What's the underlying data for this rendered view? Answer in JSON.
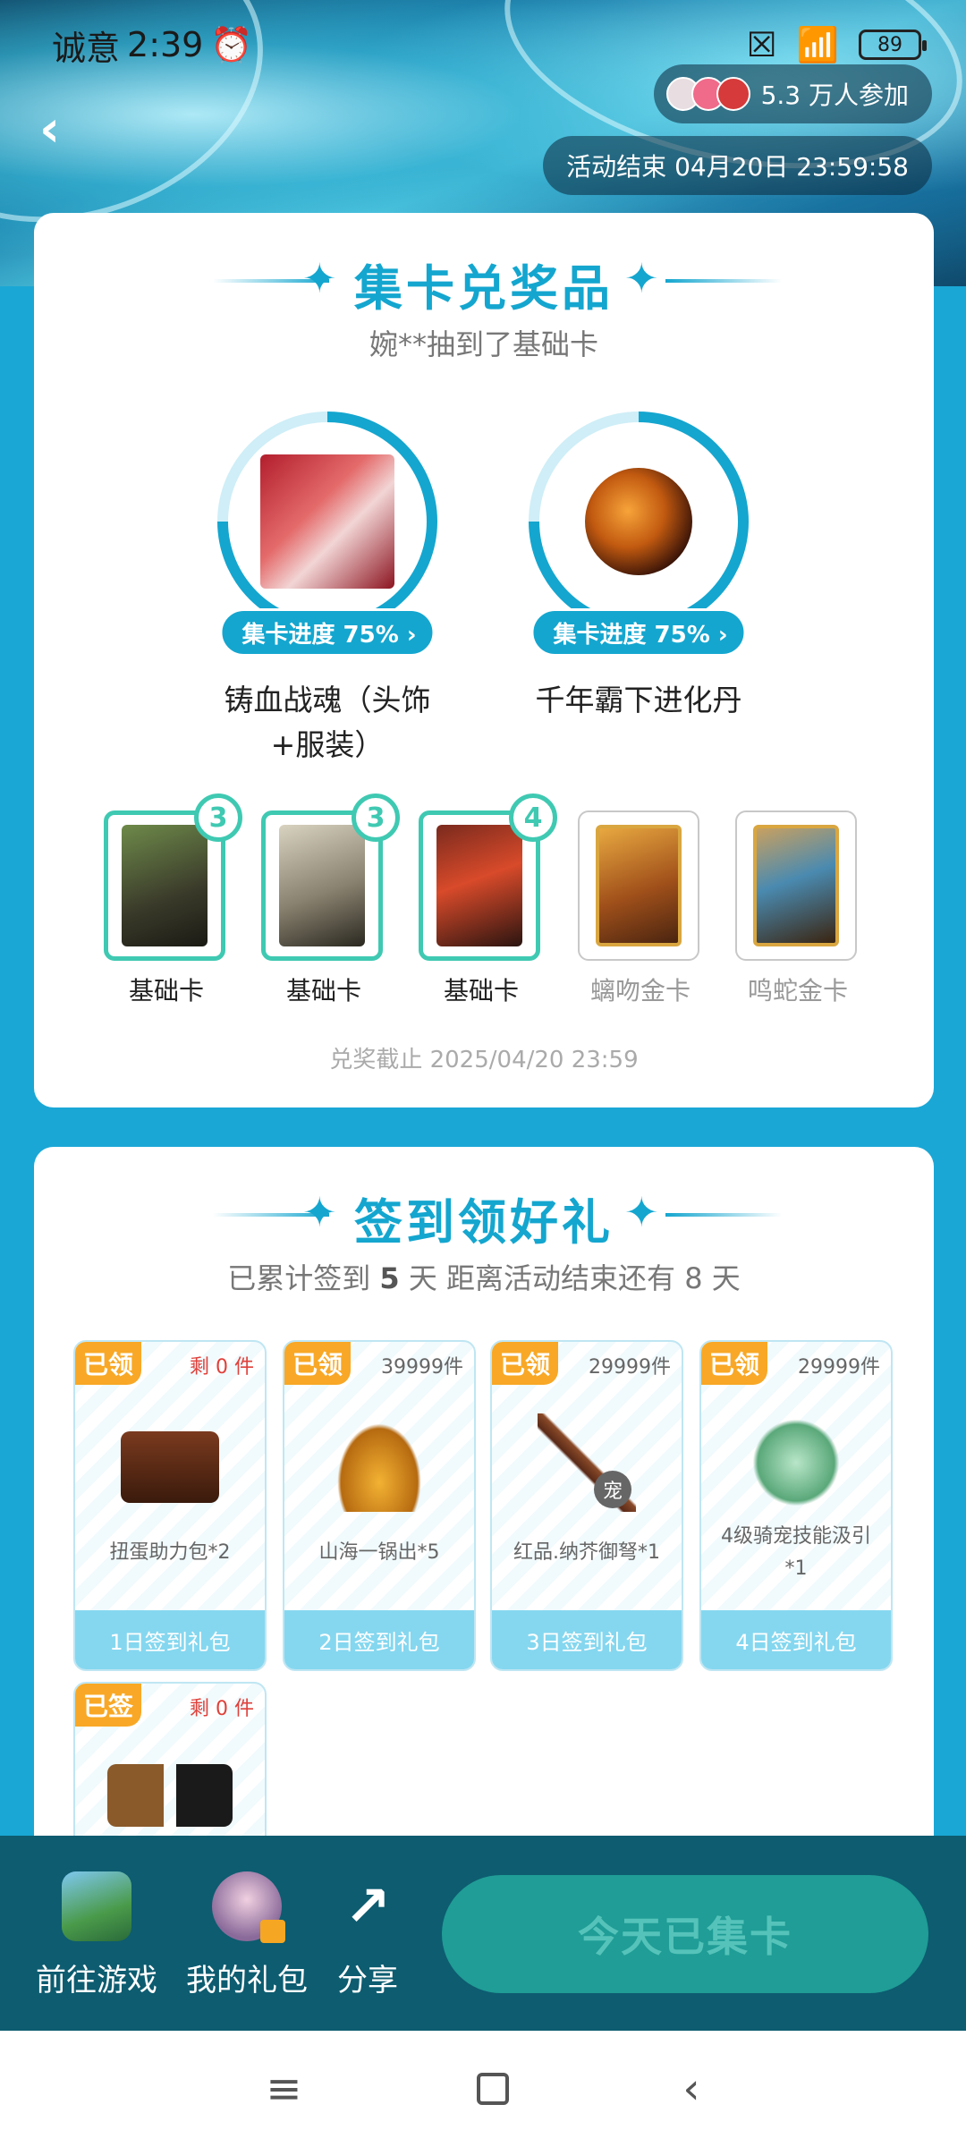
{
  "status_bar": {
    "time": "2:39",
    "carrier": "诚意",
    "battery": "89"
  },
  "header": {
    "participants": "5.3 万人参加",
    "end_time": "活动结束 04月20日 23:59:58"
  },
  "collect": {
    "title": "集卡兑奖品",
    "ticker": "婉**抽到了基础卡",
    "prizes": [
      {
        "progress_label": "集卡进度 75%",
        "progress": 0.75,
        "name_line1": "铸血战魂（头饰",
        "name_line2": "+服装）"
      },
      {
        "progress_label": "集卡进度 75%",
        "progress": 0.75,
        "name_line1": "千年霸下进化丹",
        "name_line2": ""
      }
    ],
    "cards": [
      {
        "name": "基础卡",
        "count": "3",
        "owned": true
      },
      {
        "name": "基础卡",
        "count": "3",
        "owned": true
      },
      {
        "name": "基础卡",
        "count": "4",
        "owned": true
      },
      {
        "name": "螭吻金卡",
        "count": "",
        "owned": false
      },
      {
        "name": "鸣蛇金卡",
        "count": "",
        "owned": false
      }
    ],
    "deadline": "兑奖截止 2025/04/20 23:59"
  },
  "signin": {
    "title": "签到领好礼",
    "summary_prefix": "已累计签到",
    "summary_days": "5",
    "summary_mid": "天  距离活动结束还有",
    "summary_remain": "8",
    "summary_suffix": "天",
    "gifts": [
      {
        "tag": "已领",
        "stock": "剩 0 件",
        "name": "扭蛋助力包*2",
        "footer": "1日签到礼包"
      },
      {
        "tag": "已领",
        "stock": "39999件",
        "name": "山海一锅出*5",
        "footer": "2日签到礼包"
      },
      {
        "tag": "已领",
        "stock": "29999件",
        "name": "红品.纳芥御弩*1",
        "footer": "3日签到礼包",
        "badge": "宠"
      },
      {
        "tag": "已领",
        "stock": "29999件",
        "name": "4级骑宠技能汲引*1",
        "footer": "4日签到礼包"
      },
      {
        "tag": "已签",
        "stock": "剩 0 件",
        "name": "",
        "footer": ""
      }
    ]
  },
  "bottom_bar": {
    "game": "前往游戏",
    "gifts": "我的礼包",
    "share": "分享",
    "collect_button": "今天已集卡"
  },
  "colors": {
    "accent": "#14a6cf",
    "owned_border": "#3fc9b2",
    "tag": "#f8a826",
    "bottom_bar": "#0d5c70"
  }
}
